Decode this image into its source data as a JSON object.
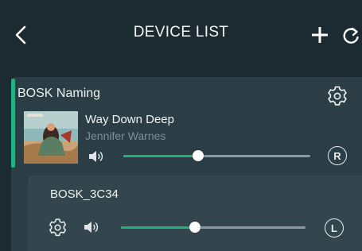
{
  "header": {
    "title": "DEVICE LIST",
    "back_icon": "chevron-left-icon",
    "add_icon": "plus-icon",
    "refresh_icon": "refresh-icon"
  },
  "group": {
    "name": "BOSK Naming",
    "settings_icon": "gear-icon",
    "now_playing": {
      "title": "Way Down Deep",
      "artist": "Jennifer Warnes",
      "album_art_icon": "album-art"
    },
    "volume": 0.4,
    "volume_icon": "speaker-icon",
    "channel": "R"
  },
  "members": [
    {
      "name": "BOSK_3C34",
      "settings_icon": "gear-icon",
      "volume_icon": "speaker-icon",
      "volume": 0.4,
      "channel": "L"
    }
  ],
  "colors": {
    "background": "#1c2a31",
    "group_card": "#2b3d45",
    "member_card": "#33464e",
    "accent": "#22b07e",
    "track": "#8d999e",
    "muted_text": "#7f9097"
  }
}
